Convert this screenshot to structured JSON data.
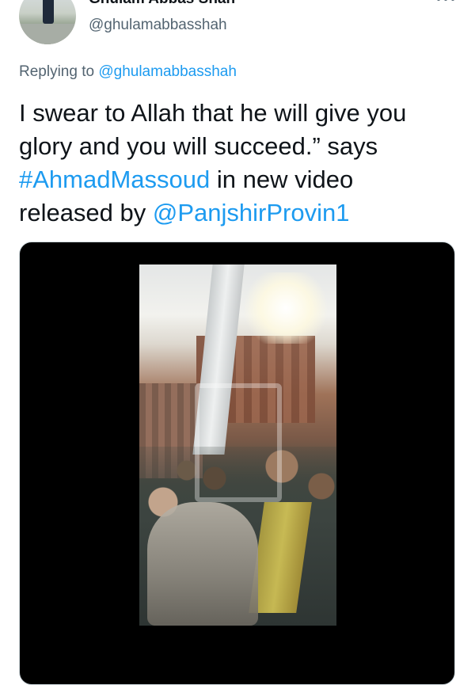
{
  "tweet": {
    "author": {
      "display_name": "Ghulam Abbas Shah",
      "handle": "@ghulamabbasshah"
    },
    "replying_to": {
      "prefix": "Replying to",
      "handle": "@ghulamabbasshah"
    },
    "text": {
      "line1": "I swear to Allah that he will give you",
      "line2": "glory and you will succeed.” says",
      "hashtag": "#AhmadMassoud",
      "after_hashtag": " in new video",
      "line4_prefix": "released by ",
      "mention": "@PanjshirProvin1"
    },
    "media": {
      "type": "video"
    }
  },
  "icons": {
    "more": "more-horizontal-icon"
  },
  "colors": {
    "link": "#1d9bf0",
    "secondary_text": "#536471",
    "primary_text": "#0f1419",
    "media_background": "#000000"
  }
}
